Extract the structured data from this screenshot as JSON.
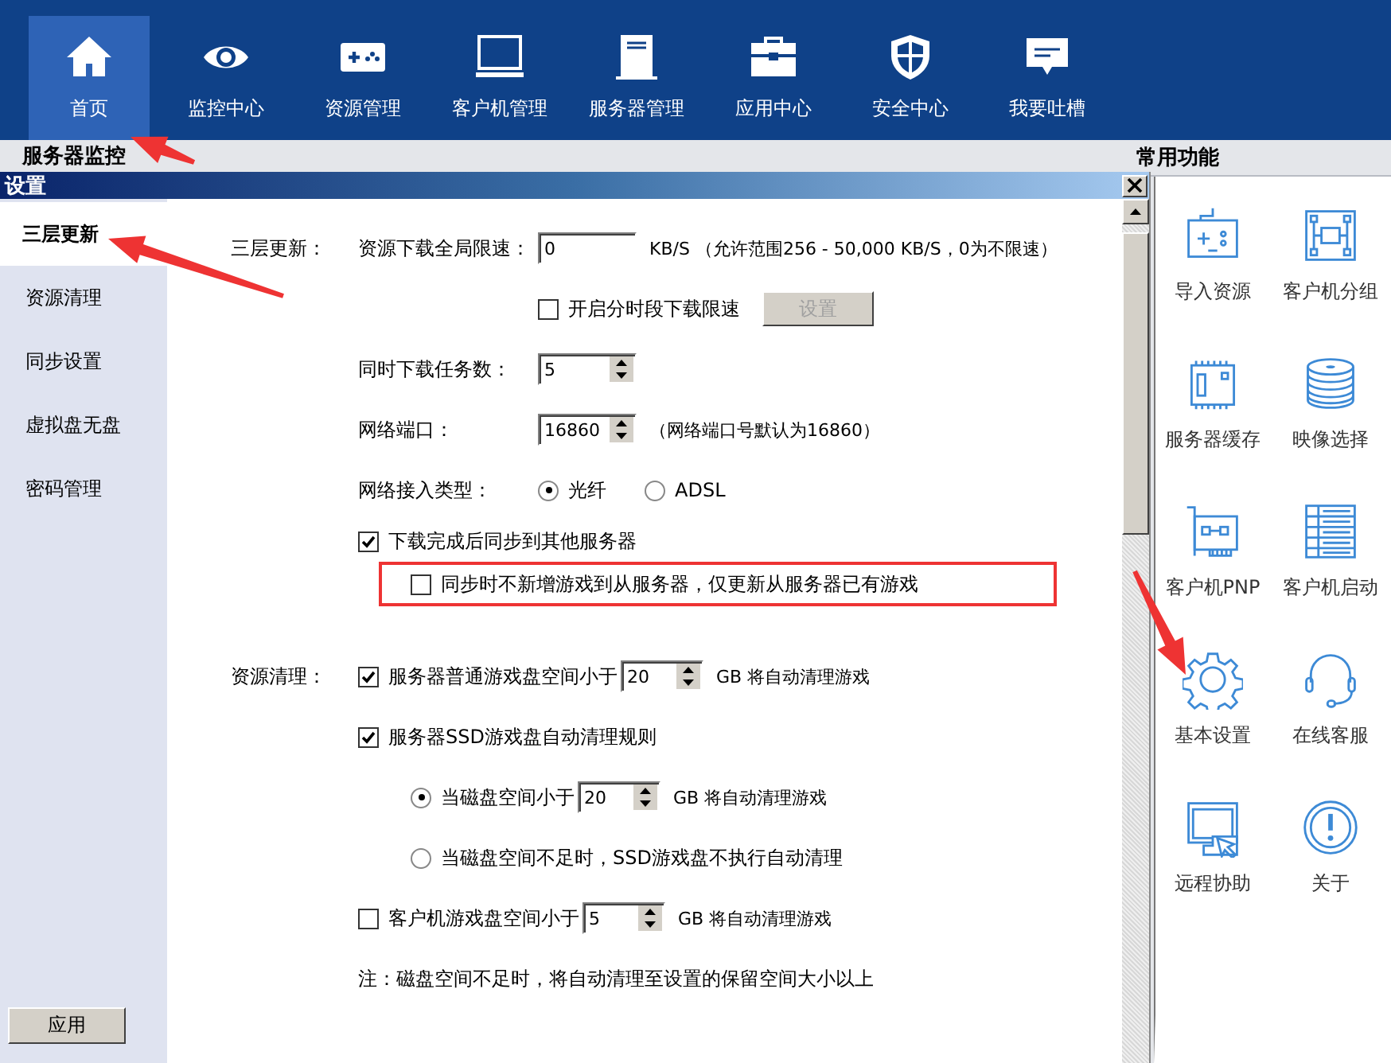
{
  "nav": [
    {
      "label": "首页",
      "selected": true,
      "pointed": true
    },
    {
      "label": "监控中心",
      "selected": false
    },
    {
      "label": "资源管理",
      "selected": false
    },
    {
      "label": "客户机管理",
      "selected": false
    },
    {
      "label": "服务器管理",
      "selected": false
    },
    {
      "label": "应用中心",
      "selected": false
    },
    {
      "label": "安全中心",
      "selected": false
    },
    {
      "label": "我要吐槽",
      "selected": false
    }
  ],
  "main_header": "服务器监控",
  "quick_panel": {
    "title": "常用功能",
    "items": [
      {
        "label": "导入资源"
      },
      {
        "label": "客户机分组"
      },
      {
        "label": "服务器缓存"
      },
      {
        "label": "映像选择"
      },
      {
        "label": "客户机PNP"
      },
      {
        "label": "客户机启动"
      },
      {
        "label": "基本设置",
        "pointed": true
      },
      {
        "label": "在线客服"
      },
      {
        "label": "远程协助"
      },
      {
        "label": "关于"
      }
    ]
  },
  "dialog": {
    "title": "设置",
    "sidebar": [
      {
        "label": "三层更新",
        "selected": true,
        "pointed": true
      },
      {
        "label": "资源清理",
        "selected": false
      },
      {
        "label": "同步设置",
        "selected": false
      },
      {
        "label": "虚拟盘无盘",
        "selected": false
      },
      {
        "label": "密码管理",
        "selected": false
      }
    ],
    "apply_button": "应用",
    "sections": [
      {
        "label": "三层更新：",
        "rows": [
          {
            "kind": "field",
            "label": "资源下载全局限速：",
            "value": "0",
            "spinner": false,
            "suffix": "KB/S （允许范围256 - 50,000 KB/S，0为不限速）"
          },
          {
            "kind": "checkbox_button",
            "text": "开启分时段下载限速",
            "checked": false,
            "button": {
              "label": "设置",
              "disabled": true
            }
          },
          {
            "kind": "field",
            "label": "同时下载任务数：",
            "value": "5",
            "spinner": true
          },
          {
            "kind": "field",
            "label": "网络端口：",
            "value": "16860",
            "spinner": true,
            "suffix": "（网络端口号默认为16860）"
          },
          {
            "kind": "radios",
            "label": "网络接入类型：",
            "options": [
              {
                "label": "光纤",
                "selected": true
              },
              {
                "label": "ADSL",
                "selected": false
              }
            ]
          },
          {
            "kind": "checkbox",
            "text": "下载完成后同步到其他服务器",
            "checked": true,
            "children": [
              {
                "kind": "checkbox",
                "text": "同步时不新增游戏到从服务器，仅更新从服务器已有游戏",
                "checked": false,
                "highlighted": true
              }
            ]
          }
        ]
      },
      {
        "label": "资源清理：",
        "rows": [
          {
            "kind": "checkbox_field",
            "text": "服务器普通游戏盘空间小于",
            "checked": true,
            "value": "20",
            "suffix": "GB 将自动清理游戏"
          },
          {
            "kind": "checkbox",
            "text": "服务器SSD游戏盘自动清理规则",
            "checked": true,
            "children": [
              {
                "kind": "radio_field",
                "text": "当磁盘空间小于",
                "selected": true,
                "value": "20",
                "suffix": "GB 将自动清理游戏"
              },
              {
                "kind": "radio",
                "text": "当磁盘空间不足时，SSD游戏盘不执行自动清理",
                "selected": false
              }
            ]
          },
          {
            "kind": "checkbox_field",
            "text": "客户机游戏盘空间小于",
            "checked": false,
            "value": "5",
            "suffix": "GB 将自动清理游戏"
          },
          {
            "kind": "note",
            "text": "注：磁盘空间不足时，将自动清理至设置的保留空间大小以上"
          }
        ]
      }
    ]
  }
}
